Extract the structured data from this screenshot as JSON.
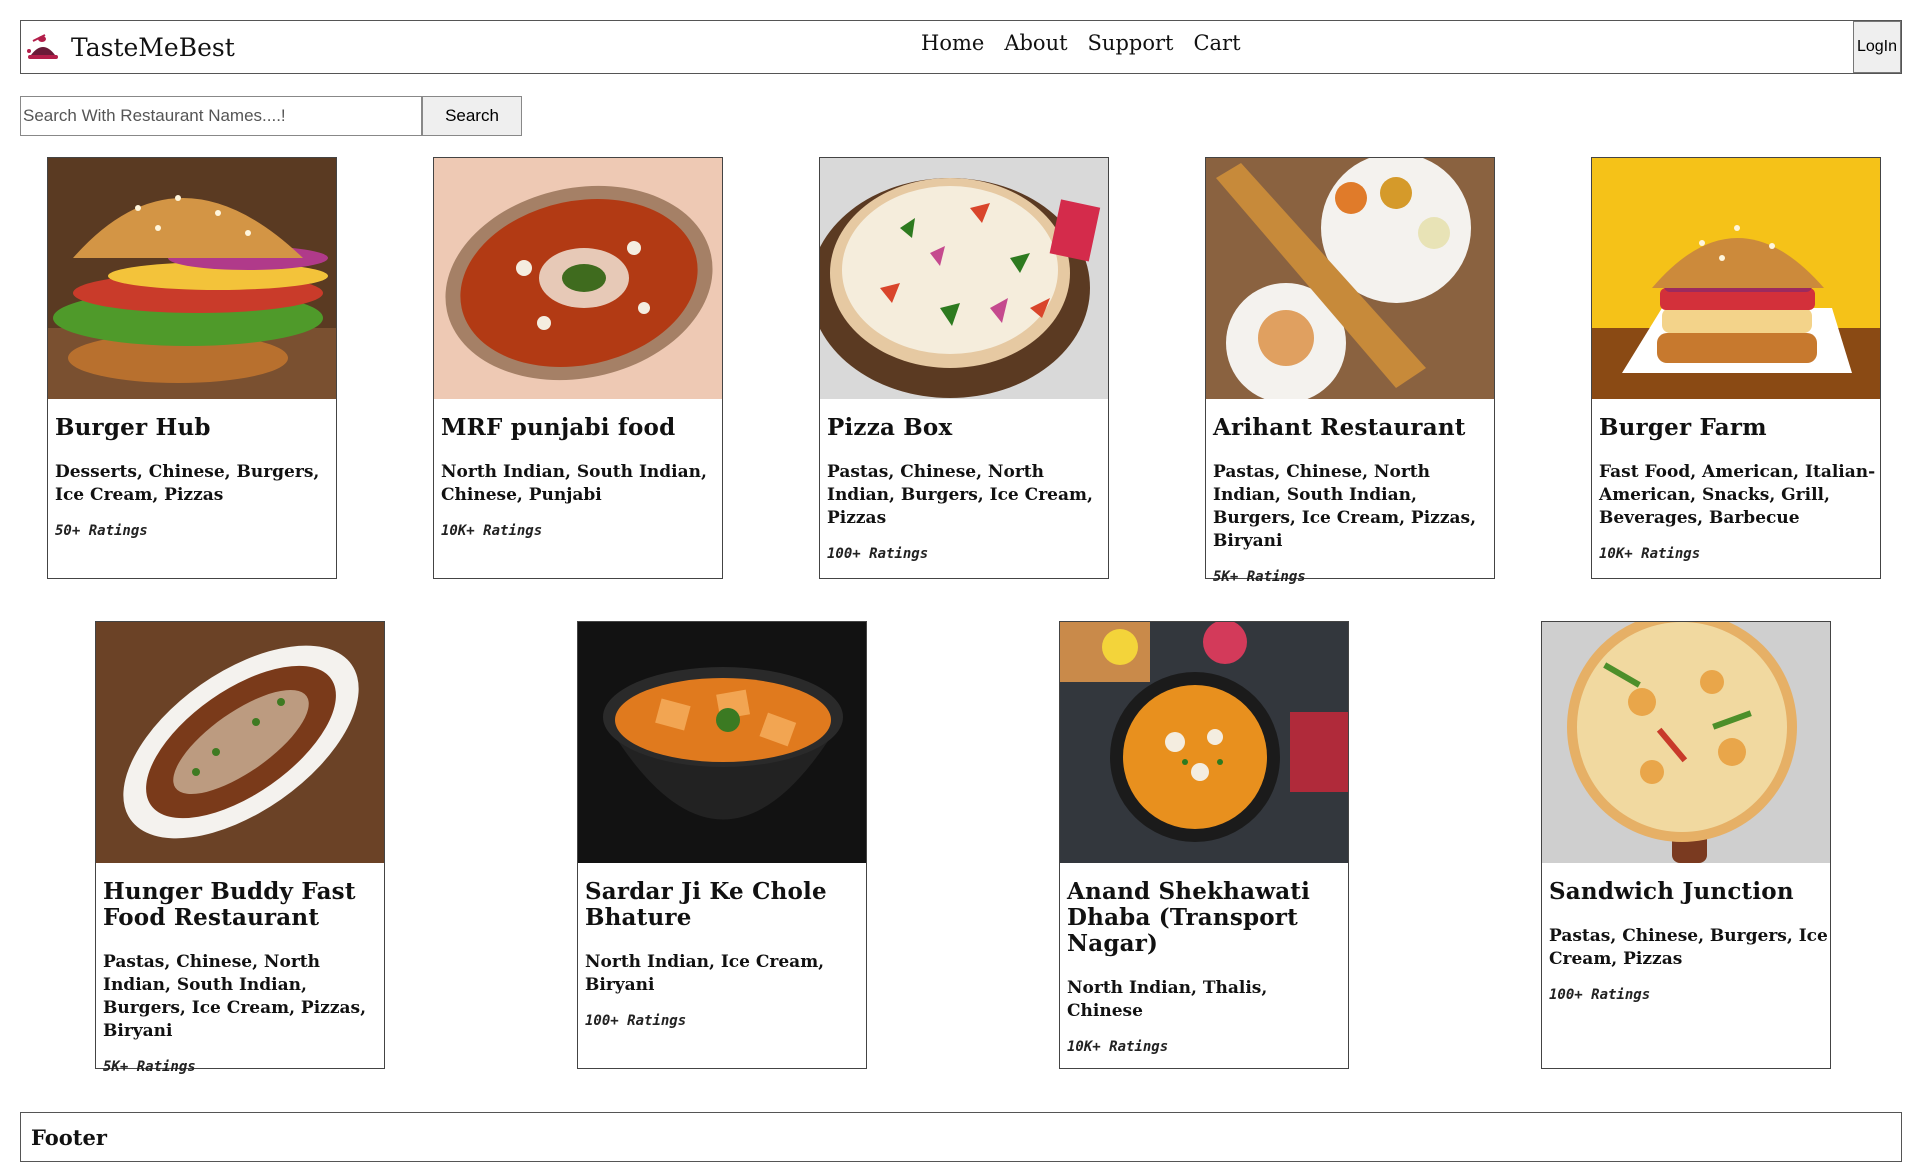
{
  "header": {
    "brand": "TasteMeBest",
    "nav": [
      "Home",
      "About",
      "Support",
      "Cart"
    ],
    "login_label": "LogIn"
  },
  "search": {
    "placeholder": "Search With Restaurant Names....!",
    "value": "",
    "button_label": "Search"
  },
  "restaurants": [
    {
      "name": "Burger Hub",
      "cuisines": "Desserts, Chinese, Burgers, Ice Cream, Pizzas",
      "ratings": "50+ Ratings",
      "image": "burger"
    },
    {
      "name": "MRF punjabi food",
      "cuisines": "North Indian, South Indian, Chinese, Punjabi",
      "ratings": "10K+ Ratings",
      "image": "curry-bowl"
    },
    {
      "name": "Pizza Box",
      "cuisines": "Pastas, Chinese, North Indian, Burgers, Ice Cream, Pizzas",
      "ratings": "100+ Ratings",
      "image": "pizza"
    },
    {
      "name": "Arihant Restaurant",
      "cuisines": "Pastas, Chinese, North Indian, South Indian, Burgers, Ice Cream, Pizzas, Biryani",
      "ratings": "5K+ Ratings",
      "image": "dosa"
    },
    {
      "name": "Burger Farm",
      "cuisines": "Fast Food, American, Italian-American, Snacks, Grill, Beverages, Barbecue",
      "ratings": "10K+ Ratings",
      "image": "burger-yellow"
    },
    {
      "name": "Hunger Buddy Fast Food Restaurant",
      "cuisines": "Pastas, Chinese, North Indian, South Indian, Burgers, Ice Cream, Pizzas, Biryani",
      "ratings": "5K+ Ratings",
      "image": "keema-plate"
    },
    {
      "name": "Sardar Ji Ke Chole Bhature",
      "cuisines": "North Indian, Ice Cream, Biryani",
      "ratings": "100+ Ratings",
      "image": "paneer-black-bowl"
    },
    {
      "name": "Anand Shekhawati Dhaba (Transport Nagar)",
      "cuisines": "North Indian, Thalis, Chinese",
      "ratings": "10K+ Ratings",
      "image": "paneer-dark"
    },
    {
      "name": "Sandwich Junction",
      "cuisines": "Pastas, Chinese, Burgers, Ice Cream, Pizzas",
      "ratings": "100+ Ratings",
      "image": "pizza-board"
    }
  ],
  "footer": {
    "label": "Footer"
  }
}
